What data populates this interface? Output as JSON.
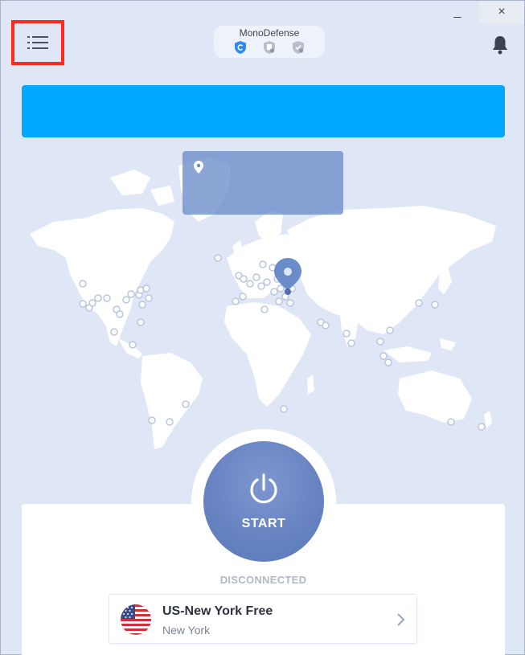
{
  "window": {
    "minimize_glyph": "_",
    "close_glyph": "×"
  },
  "header": {
    "product_title": "MonoDefense",
    "product_icons": [
      "shield-vpn-icon",
      "shield-doc-icon",
      "shield-check-icon"
    ]
  },
  "main": {
    "start_label": "START",
    "status": "DISCONNECTED"
  },
  "server": {
    "name": "US-New York Free",
    "city": "New York",
    "flag": "us-flag-icon"
  },
  "colors": {
    "banner": "#00a8ff",
    "menu_highlight": "#ff2a1a",
    "start_button": "#6683c1",
    "map_land": "#ffffff",
    "background": "#dfe7f7"
  }
}
